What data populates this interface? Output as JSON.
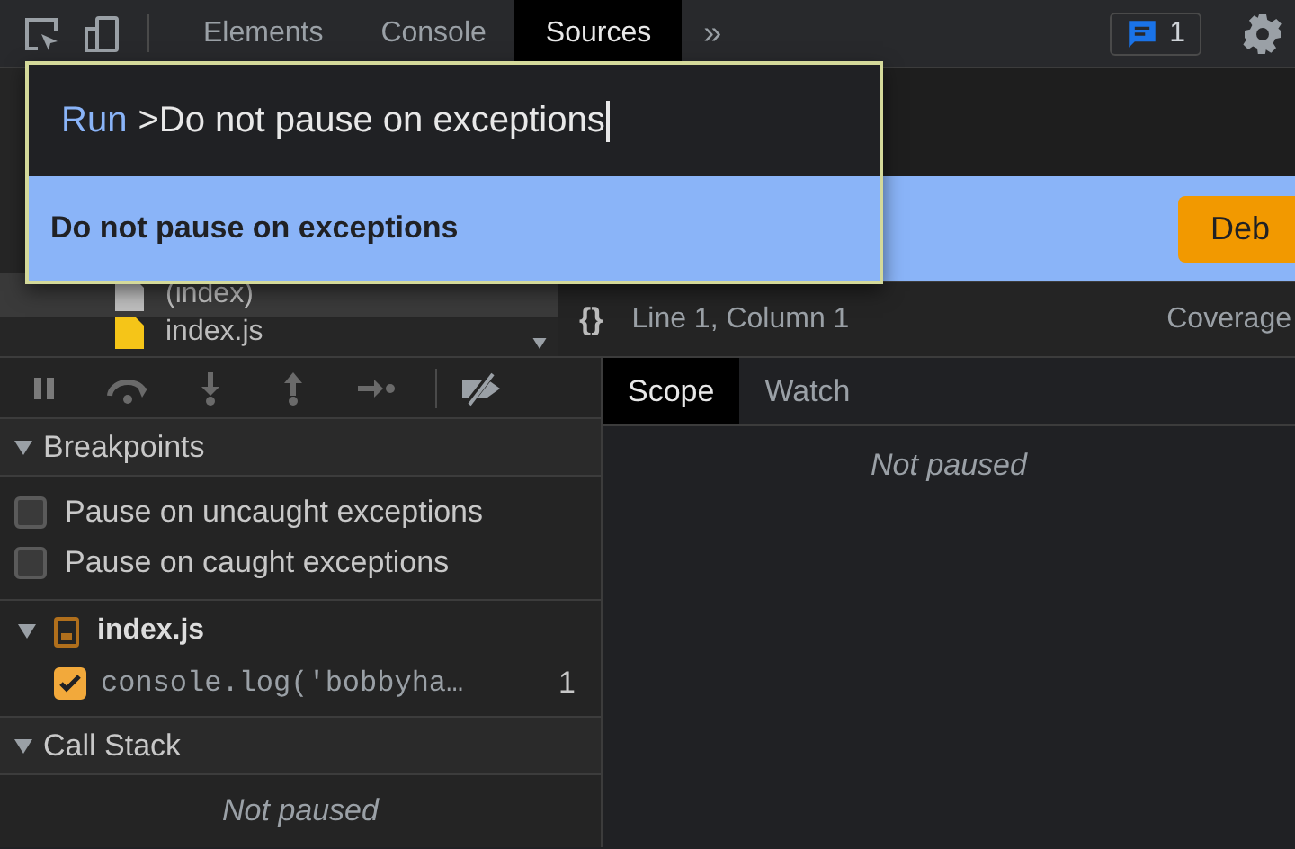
{
  "toolbar": {
    "tabs": [
      {
        "label": "Elements",
        "selected": false
      },
      {
        "label": "Console",
        "selected": false
      },
      {
        "label": "Sources",
        "selected": true
      }
    ],
    "more": "»",
    "issues_count": "1"
  },
  "command_menu": {
    "prefix": "Run",
    "value": ">Do not pause on exceptions",
    "items": [
      {
        "label": "Do not pause on exceptions",
        "selected": true
      }
    ]
  },
  "navigator": {
    "files": [
      {
        "name": "(index)",
        "kind": "html"
      },
      {
        "name": "index.js",
        "kind": "js"
      }
    ]
  },
  "banner": {
    "button": "Deb"
  },
  "editor_status": {
    "format": "{}",
    "position": "Line 1, Column 1",
    "coverage": "Coverage"
  },
  "debugger": {
    "sections": [
      {
        "kind": "breakpoints",
        "title": "Breakpoints",
        "expanded": true,
        "options": [
          {
            "label": "Pause on uncaught exceptions",
            "checked": false
          },
          {
            "label": "Pause on caught exceptions",
            "checked": false
          }
        ],
        "files": [
          {
            "name": "index.js",
            "expanded": true,
            "breakpoints": [
              {
                "code": "console.log('bobbyha…",
                "line": "1",
                "checked": true
              }
            ]
          }
        ]
      },
      {
        "kind": "message",
        "title": "Call Stack",
        "expanded": true,
        "message": "Not paused"
      }
    ]
  },
  "side_tabs": [
    {
      "label": "Scope",
      "selected": true
    },
    {
      "label": "Watch",
      "selected": false
    }
  ],
  "scope": {
    "message": "Not paused"
  }
}
